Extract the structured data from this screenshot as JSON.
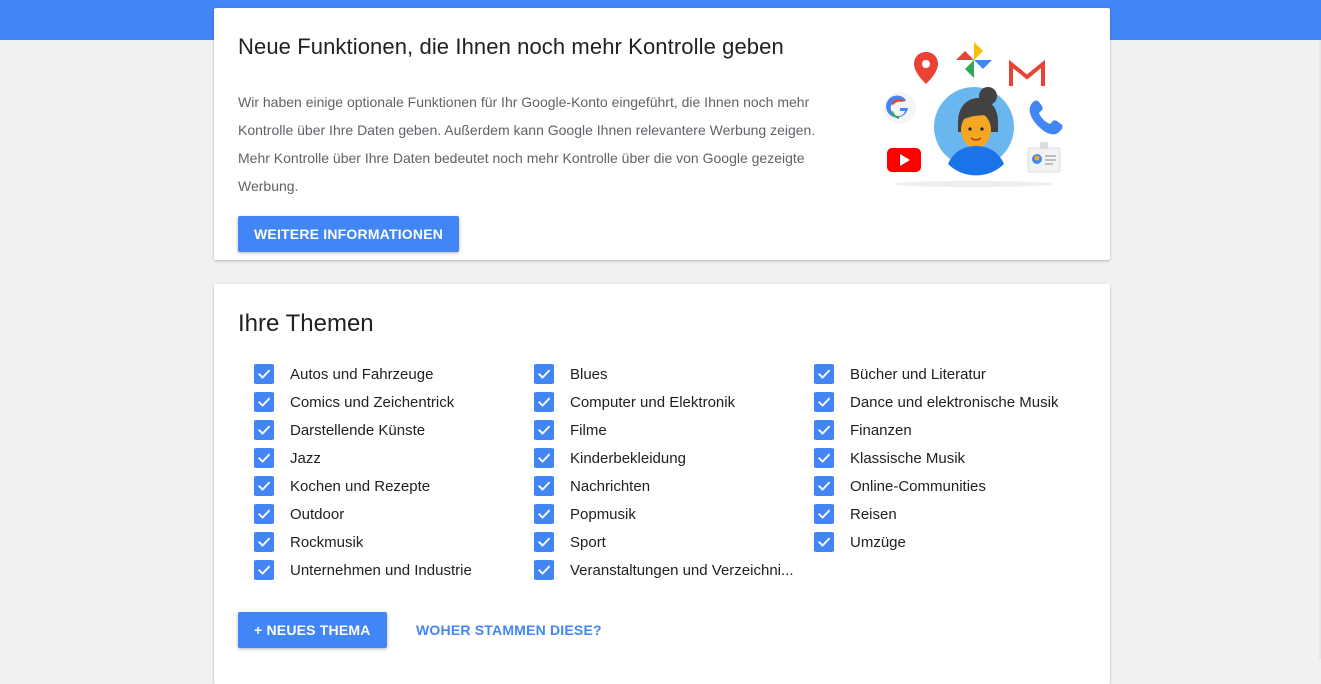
{
  "promo": {
    "title": "Neue Funktionen, die Ihnen noch mehr Kontrolle geben",
    "body": "Wir haben einige optionale Funktionen für Ihr Google-Konto eingeführt, die Ihnen noch mehr Kontrolle über Ihre Daten geben. Außerdem kann Google Ihnen relevantere Werbung zeigen. Mehr Kontrolle über Ihre Daten bedeutet noch mehr Kontrolle über die von Google gezeigte Werbung.",
    "button_label": "WEITERE INFORMATIONEN",
    "illustration_icons": [
      "maps-pin-icon",
      "photos-pinwheel-icon",
      "gmail-icon",
      "google-g-icon",
      "user-avatar-icon",
      "phone-icon",
      "youtube-icon",
      "contact-card-icon"
    ]
  },
  "topics": {
    "title": "Ihre Themen",
    "columns": [
      [
        {
          "label": "Autos und Fahrzeuge",
          "checked": true
        },
        {
          "label": "Comics und Zeichentrick",
          "checked": true
        },
        {
          "label": "Darstellende Künste",
          "checked": true
        },
        {
          "label": "Jazz",
          "checked": true
        },
        {
          "label": "Kochen und Rezepte",
          "checked": true
        },
        {
          "label": "Outdoor",
          "checked": true
        },
        {
          "label": "Rockmusik",
          "checked": true
        },
        {
          "label": "Unternehmen und Industrie",
          "checked": true
        }
      ],
      [
        {
          "label": "Blues",
          "checked": true
        },
        {
          "label": "Computer und Elektronik",
          "checked": true
        },
        {
          "label": "Filme",
          "checked": true
        },
        {
          "label": "Kinderbekleidung",
          "checked": true
        },
        {
          "label": "Nachrichten",
          "checked": true
        },
        {
          "label": "Popmusik",
          "checked": true
        },
        {
          "label": "Sport",
          "checked": true
        },
        {
          "label": "Veranstaltungen und Verzeichni...",
          "checked": true
        }
      ],
      [
        {
          "label": "Bücher und Literatur",
          "checked": true
        },
        {
          "label": "Dance und elektronische Musik",
          "checked": true
        },
        {
          "label": "Finanzen",
          "checked": true
        },
        {
          "label": "Klassische Musik",
          "checked": true
        },
        {
          "label": "Online-Communities",
          "checked": true
        },
        {
          "label": "Reisen",
          "checked": true
        },
        {
          "label": "Umzüge",
          "checked": true
        }
      ]
    ],
    "add_button_label": "+ NEUES THEMA",
    "source_link_label": "WOHER STAMMEN DIESE?"
  },
  "colors": {
    "accent": "#4285f4",
    "header_bar": "#4285f4",
    "background": "#f1f1f1"
  }
}
